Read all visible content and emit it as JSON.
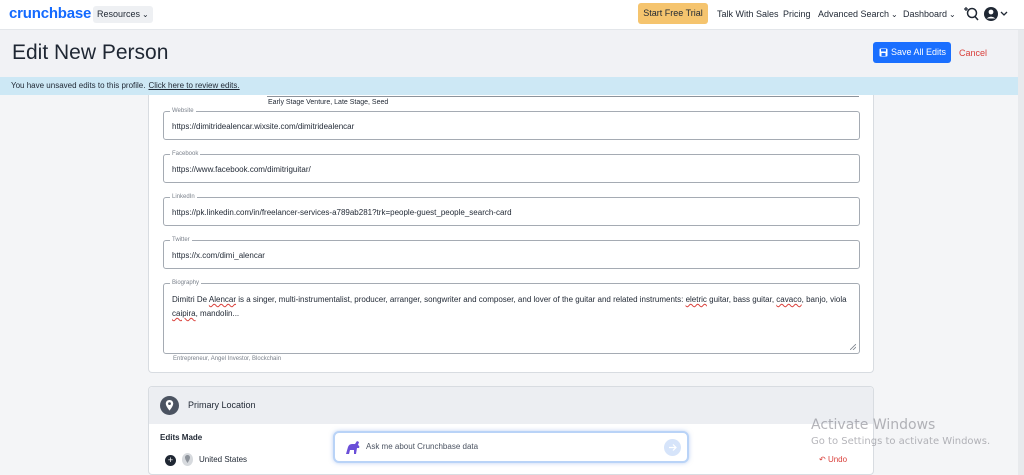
{
  "nav": {
    "logo": "crunchbase",
    "resources": "Resources",
    "start_trial": "Start Free Trial",
    "talk_sales": "Talk With Sales",
    "pricing": "Pricing",
    "advanced_search": "Advanced Search",
    "dashboard": "Dashboard"
  },
  "header": {
    "title": "Edit New Person",
    "save_label": "Save All Edits",
    "cancel_label": "Cancel"
  },
  "banner": {
    "text": "You have unsaved edits to this profile.",
    "link": "Click here to review edits."
  },
  "form": {
    "prev_value": "Early Stage Venture, Late Stage, Seed",
    "website": {
      "label": "Website",
      "value": "https://dimitridealencar.wixsite.com/dimitridealencar"
    },
    "facebook": {
      "label": "Facebook",
      "value": "https://www.facebook.com/dimitriguitar/"
    },
    "linkedin": {
      "label": "LinkedIn",
      "value": "https://pk.linkedin.com/in/freelancer-services-a789ab281?trk=people-guest_people_search-card"
    },
    "twitter": {
      "label": "Twitter",
      "value": "https://x.com/dimi_alencar"
    },
    "biography": {
      "label": "Biography",
      "p1": "Dimitri De ",
      "w1": "Alencar",
      "p2": " is a singer, multi-instrumentalist, producer, arranger, songwriter and composer, and lover of the guitar and related instruments: ",
      "w2": "eletric",
      "p3": " guitar, bass guitar, ",
      "w3": "cavaco",
      "p4": ", banjo, viola ",
      "w4": "caipira",
      "p5": ", mandolin..."
    },
    "tags": "Entrepreneur, Angel Investor, Blockchain"
  },
  "location": {
    "title": "Primary Location",
    "edits_made": "Edits Made",
    "value": "United States",
    "undo": "Undo"
  },
  "ask": {
    "placeholder": "Ask me about Crunchbase data"
  },
  "watermark": {
    "line1": "Activate Windows",
    "line2": "Go to Settings to activate Windows."
  },
  "colors": {
    "brand": "#146aff",
    "trial": "#f5c46e",
    "save": "#1a6fff",
    "danger": "#d93f3a",
    "banner": "#cde8f5"
  }
}
